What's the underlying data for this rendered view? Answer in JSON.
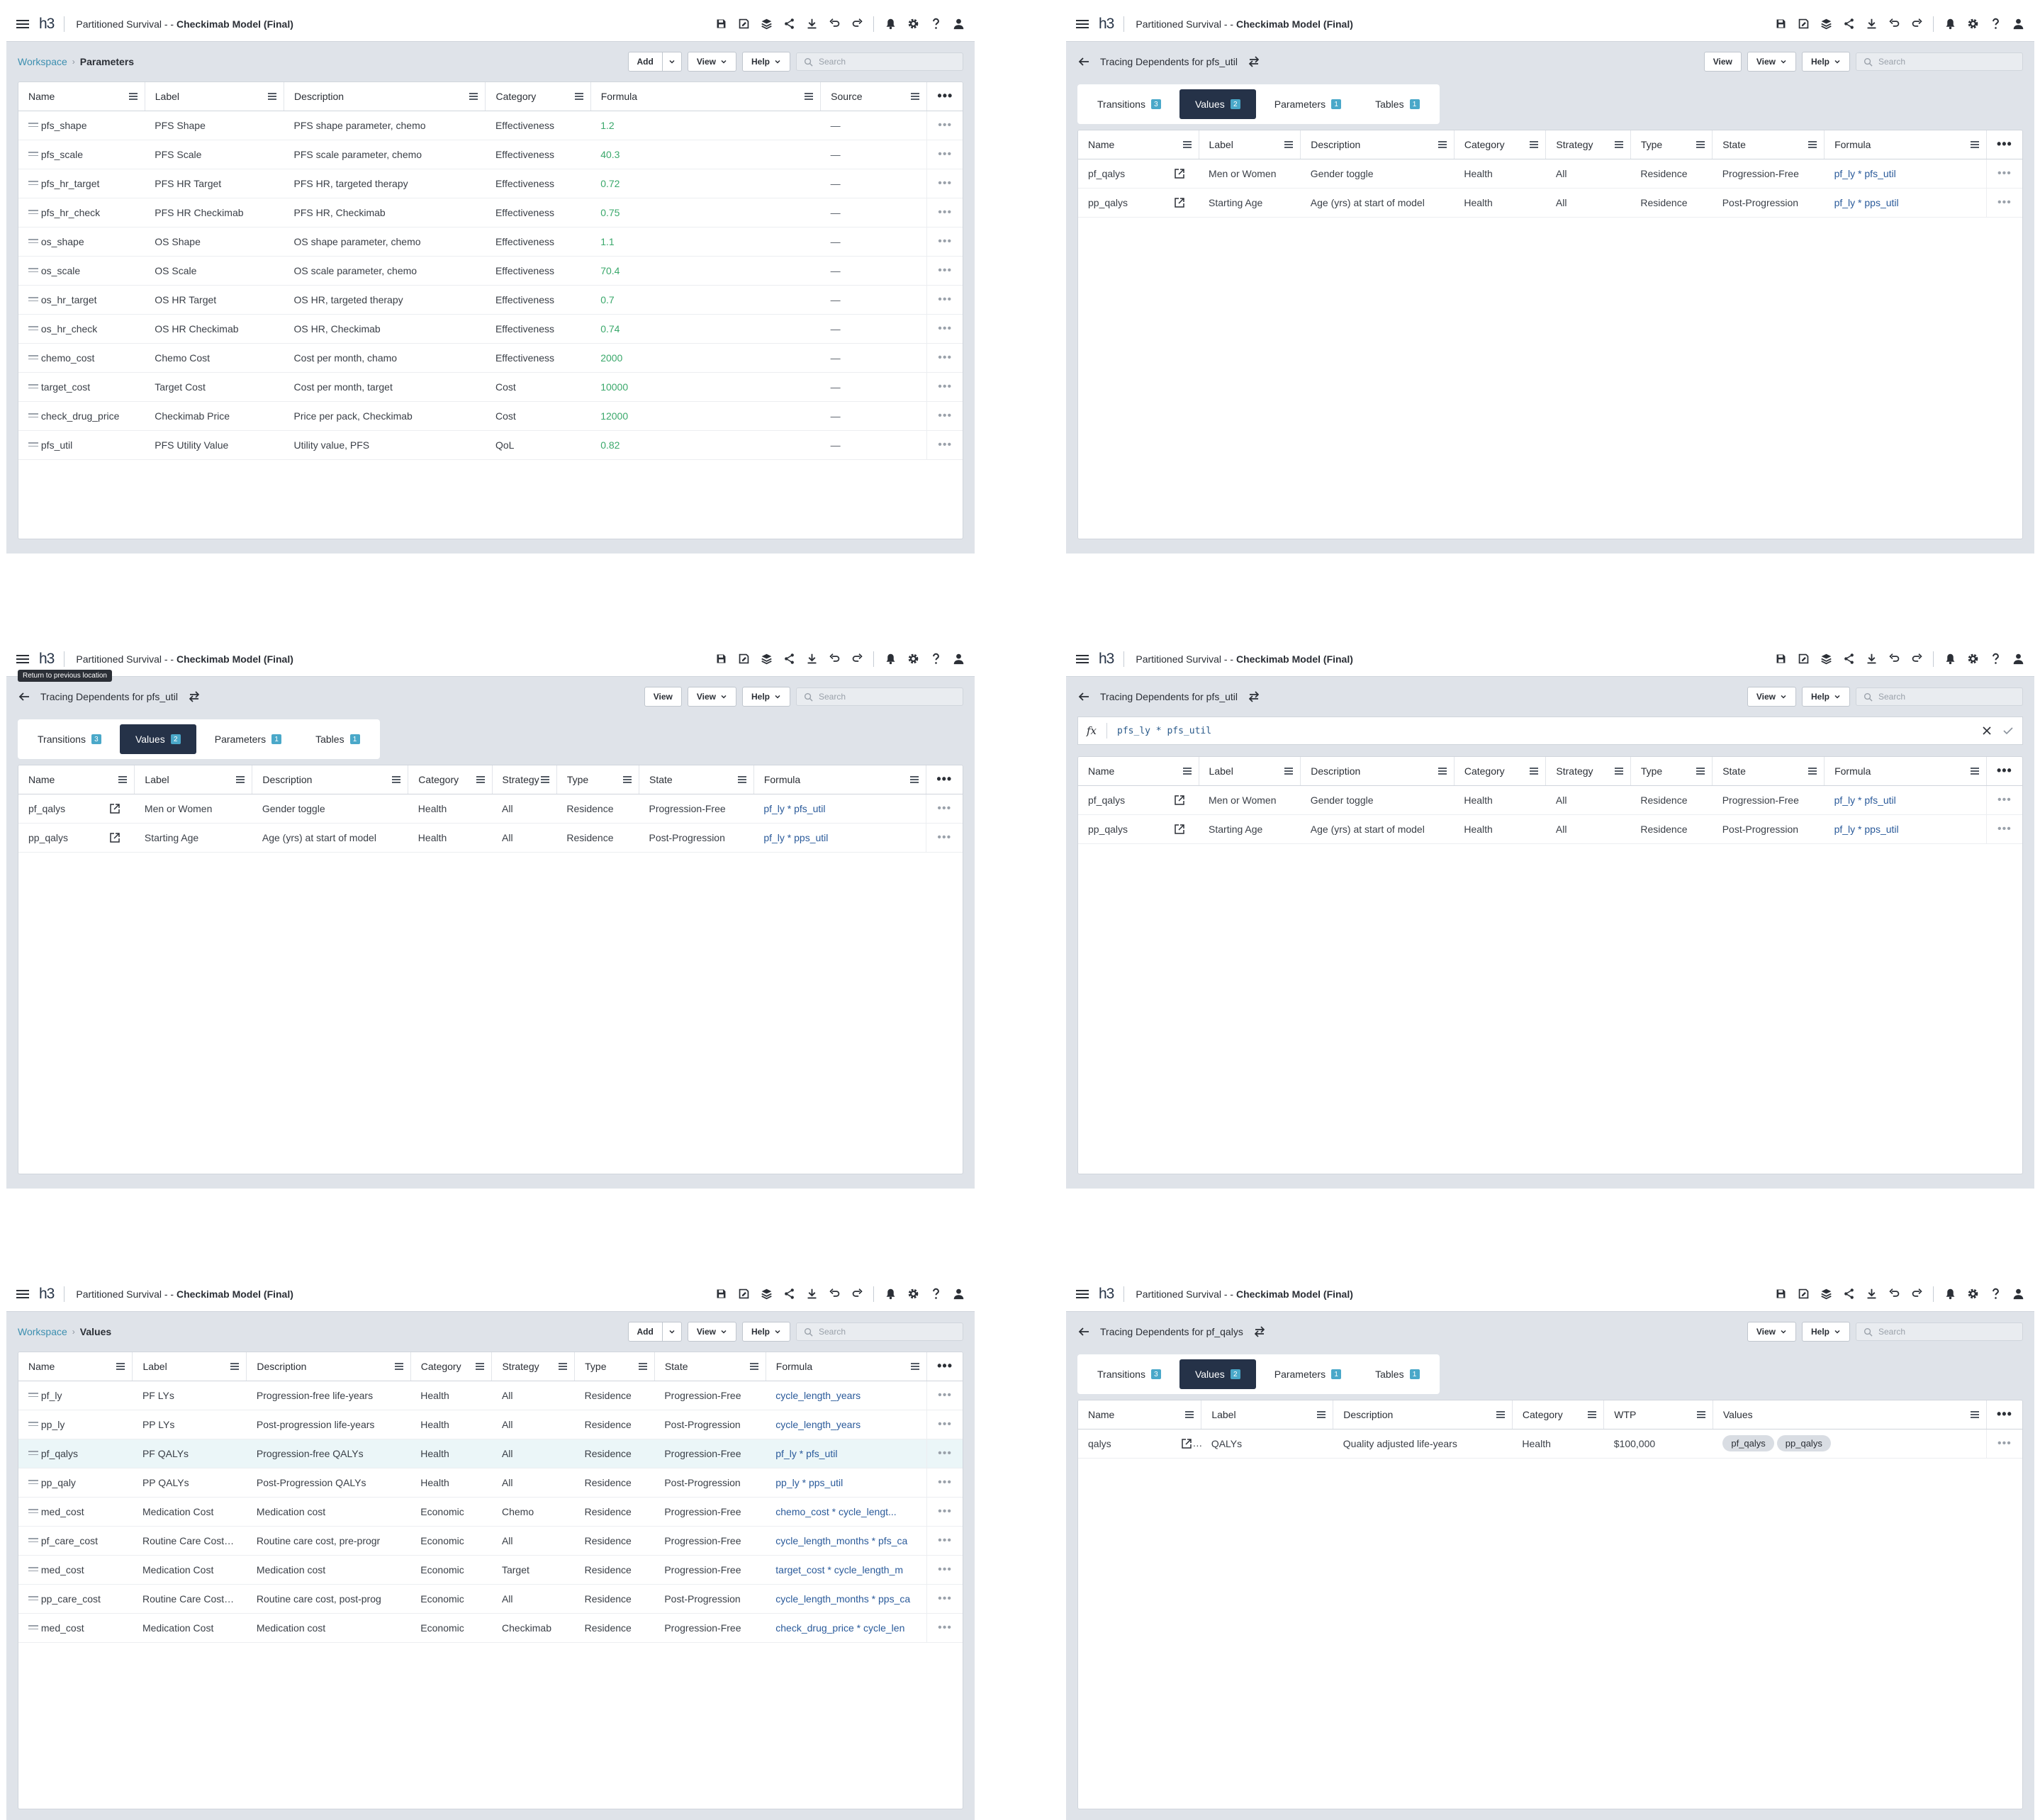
{
  "app": {
    "title_prefix": "Partitioned Survival -",
    "title_dash": "-",
    "title_model": "Checkimab Model (Final)",
    "logo": "h3"
  },
  "common": {
    "add": "Add",
    "view": "View",
    "help": "Help",
    "search_placeholder": "Search",
    "workspace": "Workspace",
    "tooltip_return": "Return to previous location",
    "more": "•••",
    "row_more": "•••",
    "dash": "—"
  },
  "panel1": {
    "crumb": "Parameters",
    "columns": [
      "Name",
      "Label",
      "Description",
      "Category",
      "Formula",
      "Source"
    ],
    "rows": [
      {
        "name": "pfs_shape",
        "label": "PFS Shape",
        "desc": "PFS shape parameter, chemo",
        "cat": "Effectiveness",
        "formula": "1.2"
      },
      {
        "name": "pfs_scale",
        "label": "PFS Scale",
        "desc": "PFS scale parameter, chemo",
        "cat": "Effectiveness",
        "formula": "40.3"
      },
      {
        "name": "pfs_hr_target",
        "label": "PFS HR Target",
        "desc": "PFS HR, targeted therapy",
        "cat": "Effectiveness",
        "formula": "0.72"
      },
      {
        "name": "pfs_hr_check",
        "label": "PFS HR Checkimab",
        "desc": "PFS HR, Checkimab",
        "cat": "Effectiveness",
        "formula": "0.75"
      },
      {
        "name": "os_shape",
        "label": "OS Shape",
        "desc": "OS shape parameter, chemo",
        "cat": "Effectiveness",
        "formula": "1.1"
      },
      {
        "name": "os_scale",
        "label": "OS Scale",
        "desc": "OS scale parameter, chemo",
        "cat": "Effectiveness",
        "formula": "70.4"
      },
      {
        "name": "os_hr_target",
        "label": "OS HR Target",
        "desc": "OS HR, targeted therapy",
        "cat": "Effectiveness",
        "formula": "0.7"
      },
      {
        "name": "os_hr_check",
        "label": "OS HR Checkimab",
        "desc": "OS HR, Checkimab",
        "cat": "Effectiveness",
        "formula": "0.74"
      },
      {
        "name": "chemo_cost",
        "label": "Chemo Cost",
        "desc": "Cost per month, chamo",
        "cat": "Effectiveness",
        "formula": "2000"
      },
      {
        "name": "target_cost",
        "label": "Target Cost",
        "desc": "Cost per month, target",
        "cat": "Cost",
        "formula": "10000"
      },
      {
        "name": "check_drug_price",
        "label": "Checkimab Price",
        "desc": "Price per pack, Checkimab",
        "cat": "Cost",
        "formula": "12000"
      },
      {
        "name": "pfs_util",
        "label": "PFS Utility Value",
        "desc": "Utility value, PFS",
        "cat": "QoL",
        "formula": "0.82"
      }
    ]
  },
  "trace_pfs_util": {
    "title": "Tracing Dependents for pfs_util",
    "tabs": [
      {
        "label": "Transitions",
        "count": "3"
      },
      {
        "label": "Values",
        "count": "2"
      },
      {
        "label": "Parameters",
        "count": "1"
      },
      {
        "label": "Tables",
        "count": "1"
      }
    ],
    "columns": [
      "Name",
      "Label",
      "Description",
      "Category",
      "Strategy",
      "Type",
      "State",
      "Formula"
    ],
    "rows": [
      {
        "name": "pf_qalys",
        "label": "Men or Women",
        "desc": "Gender toggle",
        "cat": "Health",
        "strategy": "All",
        "type": "Residence",
        "state": "Progression-Free",
        "formula": "pf_ly * pfs_util"
      },
      {
        "name": "pp_qalys",
        "label": "Starting Age",
        "desc": "Age (yrs) at start of model",
        "cat": "Health",
        "strategy": "All",
        "type": "Residence",
        "state": "Post-Progression",
        "formula": "pf_ly * pps_util"
      }
    ]
  },
  "panel4": {
    "fx": "fx",
    "formula_input": "pfs_ly * pfs_util"
  },
  "panel5": {
    "crumb": "Values",
    "columns": [
      "Name",
      "Label",
      "Description",
      "Category",
      "Strategy",
      "Type",
      "State",
      "Formula"
    ],
    "rows": [
      {
        "name": "pf_ly",
        "label": "PF LYs",
        "desc": "Progression-free life-years",
        "cat": "Health",
        "strategy": "All",
        "type": "Residence",
        "state": "Progression-Free",
        "formula": "cycle_length_years"
      },
      {
        "name": "pp_ly",
        "label": "PP LYs",
        "desc": "Post-progression life-years",
        "cat": "Health",
        "strategy": "All",
        "type": "Residence",
        "state": "Post-Progression",
        "formula": "cycle_length_years"
      },
      {
        "name": "pf_qalys",
        "label": "PF QALYs",
        "desc": "Progression-free QALYs",
        "cat": "Health",
        "strategy": "All",
        "type": "Residence",
        "state": "Progression-Free",
        "formula": "pf_ly * pfs_util"
      },
      {
        "name": "pp_qaly",
        "label": "PP QALYs",
        "desc": "Post-Progression QALYs",
        "cat": "Health",
        "strategy": "All",
        "type": "Residence",
        "state": "Post-Progression",
        "formula": "pp_ly * pps_util"
      },
      {
        "name": "med_cost",
        "label": "Medication Cost",
        "desc": "Medication cost",
        "cat": "Economic",
        "strategy": "Chemo",
        "type": "Residence",
        "state": "Progression-Free",
        "formula": "chemo_cost * cycle_lengt..."
      },
      {
        "name": "pf_care_cost",
        "label": "Routine Care Cost PF",
        "desc": "Routine care cost, pre-progr",
        "cat": "Economic",
        "strategy": "All",
        "type": "Residence",
        "state": "Progression-Free",
        "formula": "cycle_length_months * pfs_ca"
      },
      {
        "name": "med_cost",
        "label": "Medication Cost",
        "desc": "Medication cost",
        "cat": "Economic",
        "strategy": "Target",
        "type": "Residence",
        "state": "Progression-Free",
        "formula": "target_cost * cycle_length_m"
      },
      {
        "name": "pp_care_cost",
        "label": "Routine Care Cost PF",
        "desc": "Routine care cost, post-prog",
        "cat": "Economic",
        "strategy": "All",
        "type": "Residence",
        "state": "Post-Progression",
        "formula": "cycle_length_months * pps_ca"
      },
      {
        "name": "med_cost",
        "label": "Medication Cost",
        "desc": "Medication cost",
        "cat": "Economic",
        "strategy": "Checkimab",
        "type": "Residence",
        "state": "Progression-Free",
        "formula": "check_drug_price * cycle_len"
      }
    ]
  },
  "panel6": {
    "title": "Tracing Dependents for pf_qalys",
    "columns": [
      "Name",
      "Label",
      "Description",
      "Category",
      "WTP",
      "Values"
    ],
    "rows": [
      {
        "name": "qalys",
        "label": "QALYs",
        "desc": "Quality adjusted life-years",
        "cat": "Health",
        "wtp": "$100,000",
        "values": [
          "pf_qalys",
          "pp_qalys"
        ]
      }
    ]
  },
  "colors": {
    "accent": "#3d8fb0",
    "tab_active": "#253248",
    "badge": "#4aa8c9",
    "number": "#3aa86b",
    "formula": "#2a5a9a",
    "highlight_row": "#ebf6f8"
  }
}
